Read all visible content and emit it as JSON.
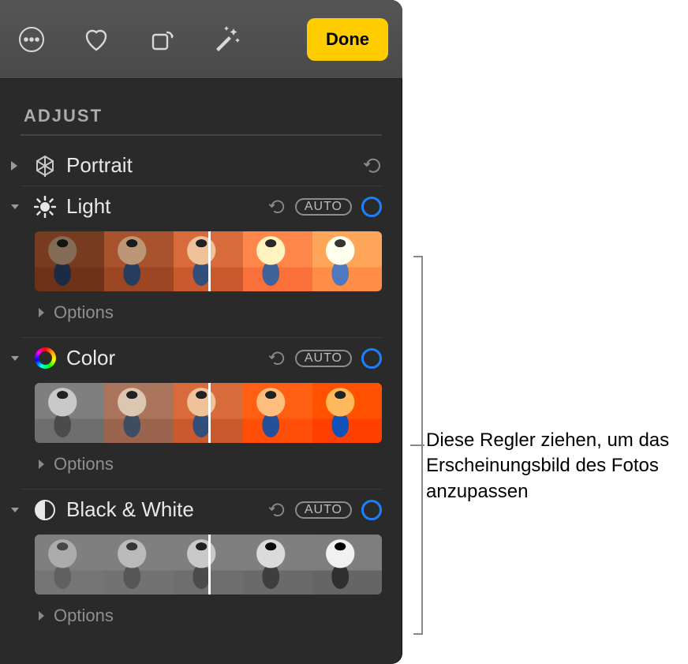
{
  "toolbar": {
    "done_label": "Done"
  },
  "adjust_title": "ADJUST",
  "portrait": {
    "label": "Portrait"
  },
  "light": {
    "label": "Light",
    "auto": "AUTO",
    "options": "Options"
  },
  "color": {
    "label": "Color",
    "auto": "AUTO",
    "options": "Options"
  },
  "bw": {
    "label": "Black & White",
    "auto": "AUTO",
    "options": "Options"
  },
  "callout": "Diese Regler ziehen, um das Erscheinungsbild des Fotos anzupassen"
}
